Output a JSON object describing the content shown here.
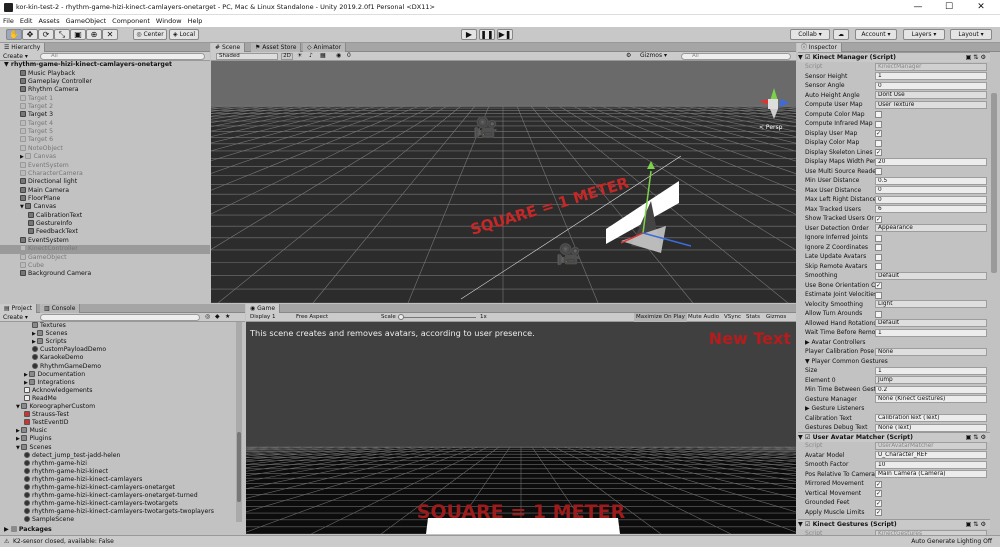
{
  "window": {
    "title": "kor-kin-test-2 - rhythm-game-hizi-kinect-camlayers-onetarget - PC, Mac & Linux Standalone - Unity 2019.2.0f1 Personal <DX11>",
    "minimize": "—",
    "maximize": "☐",
    "close": "✕"
  },
  "menu": [
    "File",
    "Edit",
    "Assets",
    "GameObject",
    "Component",
    "Window",
    "Help"
  ],
  "toolbar": {
    "center": "Center",
    "local": "Local",
    "collab": "Collab ▾",
    "cloud": "☁",
    "account": "Account ▾",
    "layers": "Layers ▾",
    "layout": "Layout ▾"
  },
  "hierarchy": {
    "tab": "Hierarchy",
    "create": "Create ▾",
    "search": "All",
    "scene": "rhythm-game-hizi-kinect-camlayers-onetarget",
    "items": [
      {
        "label": "Music Playback",
        "indent": 2,
        "grey": false
      },
      {
        "label": "Gameplay Controller",
        "indent": 2,
        "grey": false
      },
      {
        "label": "Rhythm Camera",
        "indent": 2,
        "grey": false
      },
      {
        "label": "Target 1",
        "indent": 2,
        "grey": true
      },
      {
        "label": "Target 2",
        "indent": 2,
        "grey": true
      },
      {
        "label": "Target 3",
        "indent": 2,
        "grey": false
      },
      {
        "label": "Target 4",
        "indent": 2,
        "grey": true
      },
      {
        "label": "Target 5",
        "indent": 2,
        "grey": true
      },
      {
        "label": "Target 6",
        "indent": 2,
        "grey": true
      },
      {
        "label": "NoteObject",
        "indent": 2,
        "grey": true
      },
      {
        "label": "Canvas",
        "indent": 2,
        "grey": true,
        "arrow": "▶"
      },
      {
        "label": "EventSystem",
        "indent": 2,
        "grey": true
      },
      {
        "label": "CharacterCamera",
        "indent": 2,
        "grey": true
      },
      {
        "label": "Directional light",
        "indent": 2,
        "grey": false
      },
      {
        "label": "Main Camera",
        "indent": 2,
        "grey": false
      },
      {
        "label": "FloorPlane",
        "indent": 2,
        "grey": false
      },
      {
        "label": "Canvas",
        "indent": 2,
        "grey": false,
        "arrow": "▼"
      },
      {
        "label": "CalibrationText",
        "indent": 3,
        "grey": false
      },
      {
        "label": "GestureInfo",
        "indent": 3,
        "grey": false
      },
      {
        "label": "FeedbackText",
        "indent": 3,
        "grey": false
      },
      {
        "label": "EventSystem",
        "indent": 2,
        "grey": false
      },
      {
        "label": "KinectController",
        "indent": 2,
        "grey": true,
        "selected": true
      },
      {
        "label": "GameObject",
        "indent": 2,
        "grey": true
      },
      {
        "label": "Cube",
        "indent": 2,
        "grey": true
      },
      {
        "label": "Background Camera",
        "indent": 2,
        "grey": false
      }
    ]
  },
  "scene": {
    "tabs": [
      "Scene",
      "Asset Store",
      "Animator"
    ],
    "shaded": "Shaded",
    "mode2d": "2D",
    "gizmos": "Gizmos ▾",
    "search": "All",
    "persp": "< Persp",
    "floor_text": "SQUARE = 1 METER",
    "counter": "0"
  },
  "project": {
    "tabs": [
      "Project",
      "Console"
    ],
    "create": "Create ▾",
    "items": [
      {
        "label": "Textures",
        "indent": 3,
        "type": "folder"
      },
      {
        "label": "Scenes",
        "indent": 3,
        "type": "folder",
        "arrow": "▶"
      },
      {
        "label": "Scripts",
        "indent": 3,
        "type": "folder",
        "arrow": "▶"
      },
      {
        "label": "CustomPayloadDemo",
        "indent": 3,
        "type": "unity"
      },
      {
        "label": "KaraokeDemo",
        "indent": 3,
        "type": "unity"
      },
      {
        "label": "RhythmGameDemo",
        "indent": 3,
        "type": "unity"
      },
      {
        "label": "Documentation",
        "indent": 2,
        "type": "folder",
        "arrow": "▶"
      },
      {
        "label": "Integrations",
        "indent": 2,
        "type": "folder",
        "arrow": "▶"
      },
      {
        "label": "Acknowledgements",
        "indent": 2,
        "type": "doc"
      },
      {
        "label": "ReadMe",
        "indent": 2,
        "type": "doc"
      },
      {
        "label": "KoreographerCustom",
        "indent": 1,
        "type": "folder",
        "arrow": "▼"
      },
      {
        "label": "Strauss-Test",
        "indent": 2,
        "type": "kor"
      },
      {
        "label": "TestEventID",
        "indent": 2,
        "type": "kor"
      },
      {
        "label": "Music",
        "indent": 1,
        "type": "folder",
        "arrow": "▶"
      },
      {
        "label": "Plugins",
        "indent": 1,
        "type": "folder",
        "arrow": "▶"
      },
      {
        "label": "Scenes",
        "indent": 1,
        "type": "folder",
        "arrow": "▼"
      },
      {
        "label": "detect_jump_test-jadd-helen",
        "indent": 2,
        "type": "unity"
      },
      {
        "label": "rhythm-game-hizi",
        "indent": 2,
        "type": "unity"
      },
      {
        "label": "rhythm-game-hizi-kinect",
        "indent": 2,
        "type": "unity"
      },
      {
        "label": "rhythm-game-hizi-kinect-camlayers",
        "indent": 2,
        "type": "unity"
      },
      {
        "label": "rhythm-game-hizi-kinect-camlayers-onetarget",
        "indent": 2,
        "type": "unity"
      },
      {
        "label": "rhythm-game-hizi-kinect-camlayers-onetarget-turned",
        "indent": 2,
        "type": "unity"
      },
      {
        "label": "rhythm-game-hizi-kinect-camlayers-twotargets",
        "indent": 2,
        "type": "unity"
      },
      {
        "label": "rhythm-game-hizi-kinect-camlayers-twotargets-twoplayers",
        "indent": 2,
        "type": "unity"
      },
      {
        "label": "SampleScene",
        "indent": 2,
        "type": "unity"
      }
    ],
    "packages": "Packages"
  },
  "game": {
    "tab": "Game",
    "display": "Display 1",
    "aspect": "Free Aspect",
    "scale_label": "Scale",
    "scale_val": "1x",
    "maximize": "Maximize On Play",
    "mute": "Mute Audio",
    "vsync": "VSync",
    "stats": "Stats",
    "gizmos": "Gizmos",
    "message": "This scene creates and removes avatars, according to user presence.",
    "newtext": "New Text",
    "floor_text": "SQUARE = 1 METER"
  },
  "inspector": {
    "tab": "Inspector",
    "comp1": "Kinect Manager (Script)",
    "rows1": [
      {
        "label": "Script",
        "value": "KinectManager",
        "kind": "ro"
      },
      {
        "label": "Sensor Height",
        "value": "1",
        "kind": "field"
      },
      {
        "label": "Sensor Angle",
        "value": "0",
        "kind": "field"
      },
      {
        "label": "Auto Height Angle",
        "value": "Dont Use",
        "kind": "drop"
      },
      {
        "label": "Compute User Map",
        "value": "User Texture",
        "kind": "drop"
      },
      {
        "label": "Compute Color Map",
        "value": "",
        "kind": "chk"
      },
      {
        "label": "Compute Infrared Map",
        "value": "",
        "kind": "chk"
      },
      {
        "label": "Display User Map",
        "value": "✓",
        "kind": "chk"
      },
      {
        "label": "Display Color Map",
        "value": "",
        "kind": "chk"
      },
      {
        "label": "Display Skeleton Lines",
        "value": "✓",
        "kind": "chk"
      },
      {
        "label": "Display Maps Width Per",
        "value": "20",
        "kind": "field"
      },
      {
        "label": "Use Multi Source Reade",
        "value": "",
        "kind": "chk"
      },
      {
        "label": "Min User Distance",
        "value": "0.5",
        "kind": "field"
      },
      {
        "label": "Max User Distance",
        "value": "0",
        "kind": "field"
      },
      {
        "label": "Max Left Right Distance",
        "value": "0",
        "kind": "field"
      },
      {
        "label": "Max Tracked Users",
        "value": "6",
        "kind": "field"
      },
      {
        "label": "Show Tracked Users Or",
        "value": "✓",
        "kind": "chk"
      },
      {
        "label": "User Detection Order",
        "value": "Appearance",
        "kind": "drop"
      },
      {
        "label": "Ignore Inferred Joints",
        "value": "",
        "kind": "chk"
      },
      {
        "label": "Ignore Z Coordinates",
        "value": "",
        "kind": "chk"
      },
      {
        "label": "Late Update Avatars",
        "value": "",
        "kind": "chk"
      },
      {
        "label": "Skip Remote Avatars",
        "value": "",
        "kind": "chk"
      },
      {
        "label": "Smoothing",
        "value": "Default",
        "kind": "drop"
      },
      {
        "label": "Use Bone Orientation C",
        "value": "✓",
        "kind": "chk"
      },
      {
        "label": "Estimate Joint Velocities",
        "value": "",
        "kind": "chk"
      },
      {
        "label": "Velocity Smoothing",
        "value": "Light",
        "kind": "drop"
      },
      {
        "label": "Allow Turn Arounds",
        "value": "",
        "kind": "chk"
      },
      {
        "label": "Allowed Hand Rotations",
        "value": "Default",
        "kind": "drop"
      },
      {
        "label": "Wait Time Before Remo",
        "value": "1",
        "kind": "field"
      },
      {
        "label": "▶ Avatar Controllers",
        "value": "",
        "kind": "none"
      },
      {
        "label": "Player Calibration Pose",
        "value": "None",
        "kind": "drop"
      },
      {
        "label": "▼ Player Common Gestures",
        "value": "",
        "kind": "none"
      },
      {
        "label": "    Size",
        "value": "1",
        "kind": "field"
      },
      {
        "label": "    Element 0",
        "value": "Jump",
        "kind": "drop"
      },
      {
        "label": "Min Time Between Gest",
        "value": "0.2",
        "kind": "field"
      },
      {
        "label": "Gesture Manager",
        "value": "None (Kinect Gestures)",
        "kind": "field"
      },
      {
        "label": "▶ Gesture Listeners",
        "value": "",
        "kind": "none"
      },
      {
        "label": "Calibration Text",
        "value": "CalibrationText (Text)",
        "kind": "field"
      },
      {
        "label": "Gestures Debug Text",
        "value": "None (Text)",
        "kind": "field"
      }
    ],
    "comp2": "User Avatar Matcher (Script)",
    "rows2": [
      {
        "label": "Script",
        "value": "UserAvatarMatcher",
        "kind": "ro"
      },
      {
        "label": "Avatar Model",
        "value": "U_Character_REF",
        "kind": "field"
      },
      {
        "label": "Smooth Factor",
        "value": "10",
        "kind": "field"
      },
      {
        "label": "Pos Relative To Camera",
        "value": "Main Camera (Camera)",
        "kind": "field"
      },
      {
        "label": "Mirrored Movement",
        "value": "✓",
        "kind": "chk"
      },
      {
        "label": "Vertical Movement",
        "value": "✓",
        "kind": "chk"
      },
      {
        "label": "Grounded Feet",
        "value": "✓",
        "kind": "chk"
      },
      {
        "label": "Apply Muscle Limits",
        "value": "✓",
        "kind": "chk"
      }
    ],
    "comp3": "Kinect Gestures (Script)",
    "script3": "KinectGestures"
  },
  "status": {
    "left": "K2-sensor closed, available: False",
    "right": "Auto Generate Lighting Off"
  }
}
